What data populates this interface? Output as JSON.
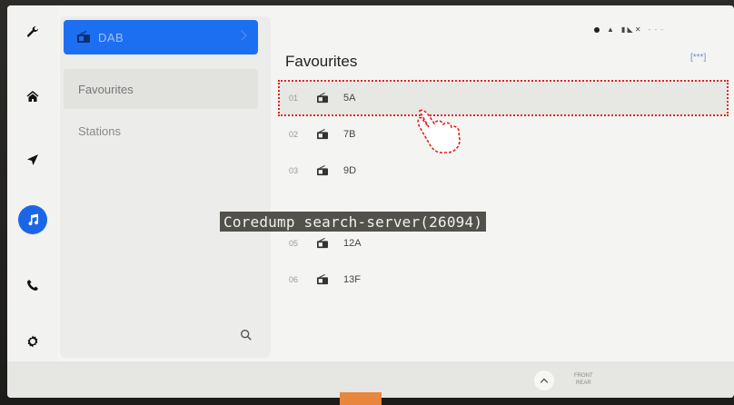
{
  "source": {
    "label": "DAB"
  },
  "menu": {
    "items": [
      {
        "label": "Favourites",
        "selected": true
      },
      {
        "label": "Stations",
        "selected": false
      }
    ]
  },
  "content": {
    "title": "Favourites",
    "more_label": "[***]"
  },
  "favourites": [
    {
      "num": "01",
      "name": "5A",
      "highlighted": true
    },
    {
      "num": "02",
      "name": "7B"
    },
    {
      "num": "03",
      "name": "9D"
    },
    {
      "num": "05",
      "name": "12A"
    },
    {
      "num": "06",
      "name": "13F"
    }
  ],
  "overlay": {
    "text": "Coredump search-server(26094)"
  },
  "bottom": {
    "front_label": "FRONT",
    "rear_label": "REAR"
  },
  "rail": {
    "icons": [
      "wrench-icon",
      "home-icon",
      "navigation-icon",
      "music-icon",
      "phone-icon",
      "settings-icon"
    ],
    "active": "music-icon"
  },
  "colors": {
    "accent": "#1d6ff2",
    "highlight_outline": "#e0201e",
    "overlay_bg": "#3c3a34"
  }
}
